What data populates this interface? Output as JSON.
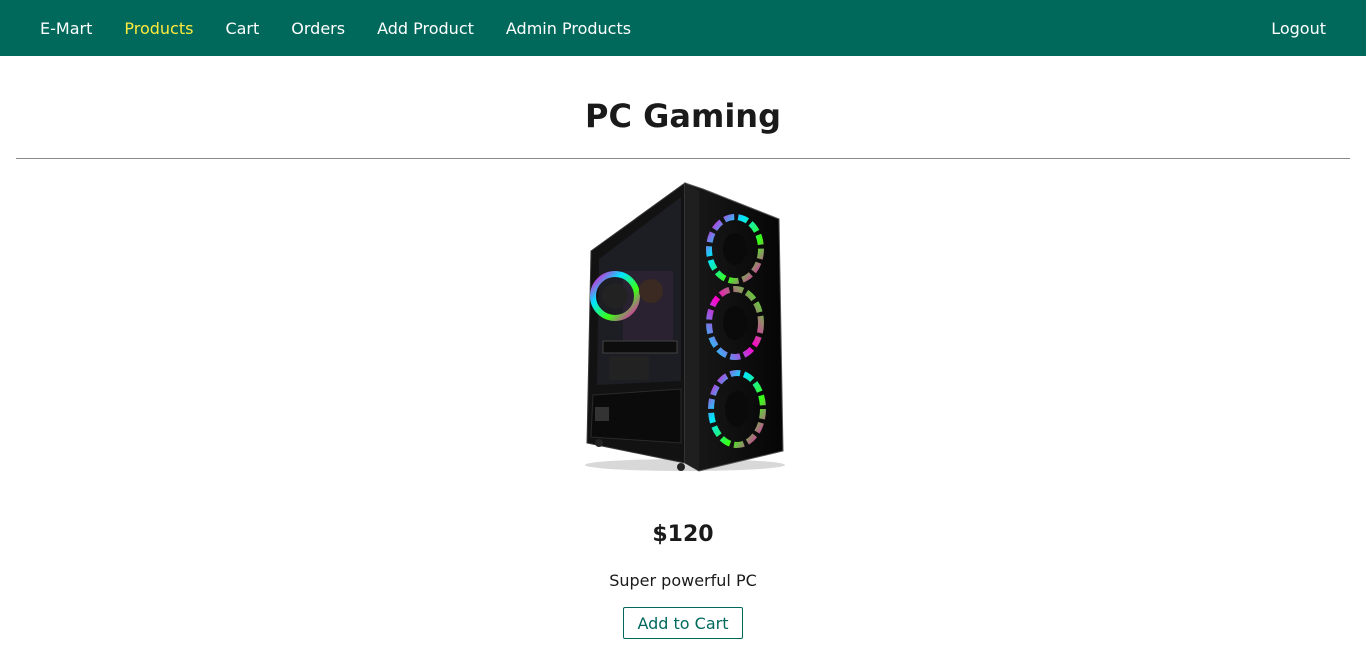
{
  "nav": {
    "brand": "E-Mart",
    "links": [
      "Products",
      "Cart",
      "Orders",
      "Add Product",
      "Admin Products"
    ],
    "active": "Products",
    "logout": "Logout"
  },
  "product": {
    "title": "PC Gaming",
    "price": "$120",
    "description": "Super powerful PC",
    "add_to_cart_label": "Add to Cart"
  },
  "colors": {
    "navbar_bg": "#00695c",
    "nav_text": "#ffffff",
    "nav_active": "#ffeb3b",
    "button_accent": "#00695c"
  }
}
